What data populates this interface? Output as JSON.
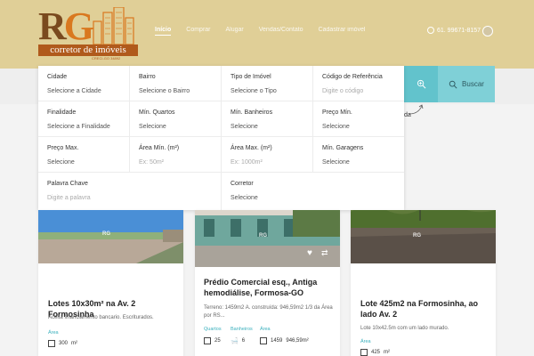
{
  "logo": {
    "letter1": "R",
    "letter2": "G",
    "band": "corretor de imóveis",
    "creci": "CRECI-GO 34892"
  },
  "nav": [
    "Início",
    "Comprar",
    "Alugar",
    "Vendas/Contato",
    "Cadastrar imóvel"
  ],
  "phone": "61. 99671-8157",
  "colors": {
    "header": "#e0cf97",
    "accent": "#62c3cc",
    "brand": "#b05a1c"
  },
  "search": {
    "map_icon": "map-icon",
    "button_label": "Buscar"
  },
  "bg_text": "da",
  "filters": [
    {
      "label": "Cidade",
      "value": "Selecione a Cidade"
    },
    {
      "label": "Bairro",
      "value": "Selecione o Bairro"
    },
    {
      "label": "Tipo de Imóvel",
      "value": "Selecione o Tipo"
    },
    {
      "label": "Código de Referência",
      "placeholder": "Digite o código"
    },
    {
      "label": "Finalidade",
      "value": "Selecione a Finalidade"
    },
    {
      "label": "Mín. Quartos",
      "value": "Selecione"
    },
    {
      "label": "Mín. Banheiros",
      "value": "Selecione"
    },
    {
      "label": "Preço Mín.",
      "value": "Selecione"
    },
    {
      "label": "Preço Max.",
      "value": "Selecione"
    },
    {
      "label": "Área Mín. (m²)",
      "placeholder": "Ex: 50m²"
    },
    {
      "label": "Área Max. (m²)",
      "placeholder": "Ex: 1000m²"
    },
    {
      "label": "Mín. Garagens",
      "value": "Selecione"
    },
    {
      "label": "Palavra Chave",
      "placeholder": "Digite a palavra"
    },
    {
      "label": "Corretor",
      "value": "Selecione"
    }
  ],
  "cards": [
    {
      "title": "Lotes 10x30m² na Av. 2 Formosinha",
      "desc": "Aceita financiamento bancario. Escriturados.",
      "area_label": "Área",
      "area_value": "300",
      "area_unit": "m²",
      "watermark": "RG"
    },
    {
      "title": "Prédio Comercial esq., Antiga hemodiálise, Formosa-GO",
      "desc": "Terreno: 1459m2 A. construída: 946,59m2 1/3 da Área por RS...",
      "labels": [
        "Quartos",
        "Banheiros",
        "Área"
      ],
      "values": [
        "25",
        "6",
        "1459",
        "946,59m²"
      ],
      "watermark": "RG"
    },
    {
      "title": "Lote 425m2 na Formosinha, ao lado Av. 2",
      "desc": "Lote 10x42.5m com um lado murado.",
      "area_label": "Área",
      "area_value": "425",
      "area_unit": "m²",
      "watermark": "RG"
    }
  ]
}
